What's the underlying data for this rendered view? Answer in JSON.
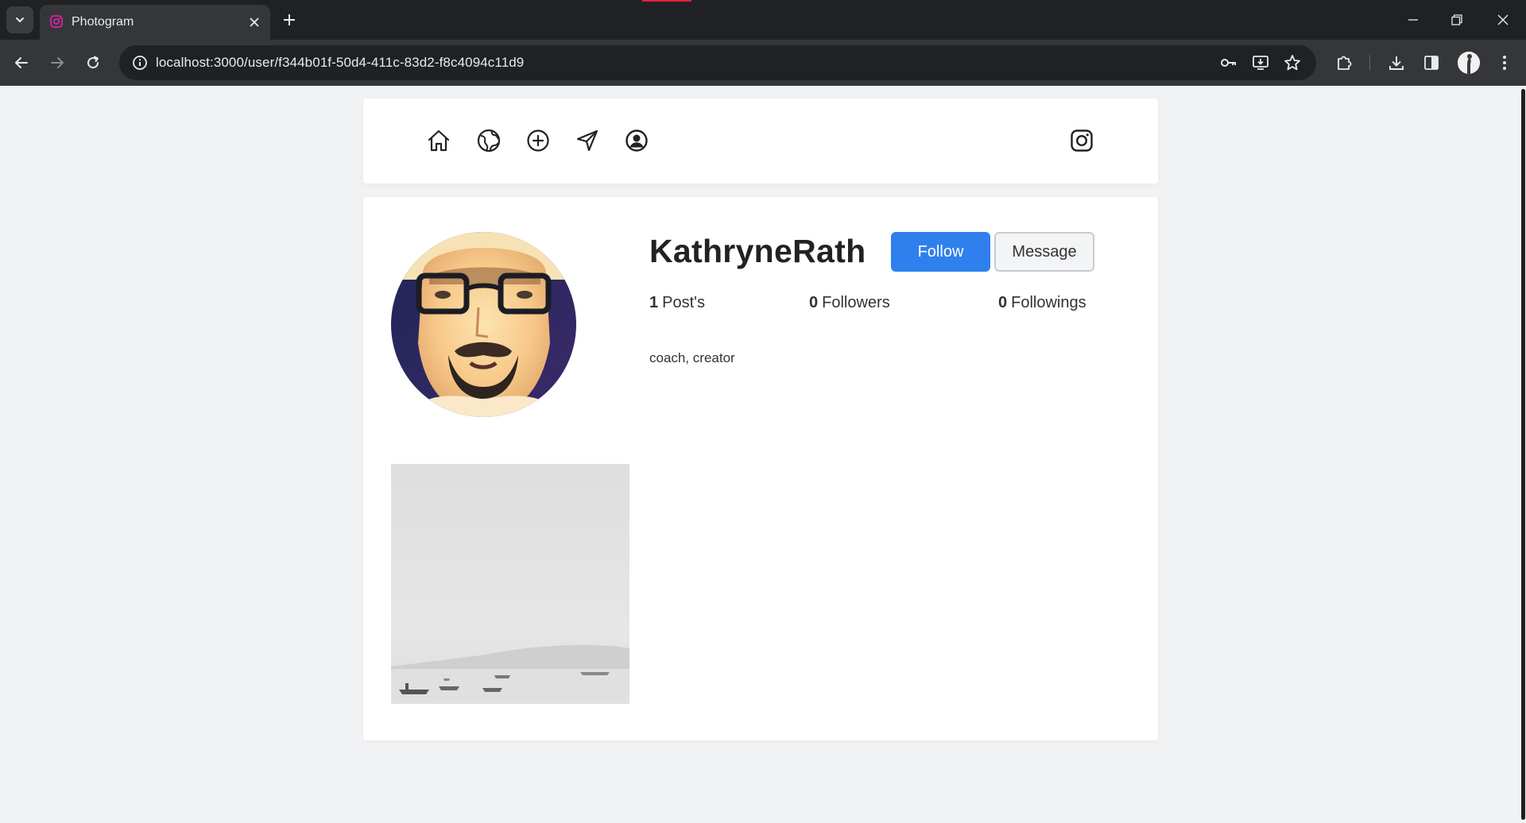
{
  "browser": {
    "tab_title": "Photogram",
    "url": "localhost:3000/user/f344b01f-50d4-411c-83d2-f8c4094c11d9"
  },
  "nav": {
    "icons": [
      "home-icon",
      "explore-globe-icon",
      "new-post-icon",
      "direct-message-icon",
      "profile-icon"
    ],
    "brand_icon": "instagram-icon"
  },
  "profile": {
    "username": "KathryneRath",
    "follow_label": "Follow",
    "message_label": "Message",
    "posts_count": "1",
    "posts_label": "Post's",
    "followers_count": "0",
    "followers_label": "Followers",
    "followings_count": "0",
    "followings_label": "Followings",
    "bio": "coach, creator"
  },
  "colors": {
    "accent": "#2f80ed",
    "page_bg": "#f1f2f4"
  }
}
